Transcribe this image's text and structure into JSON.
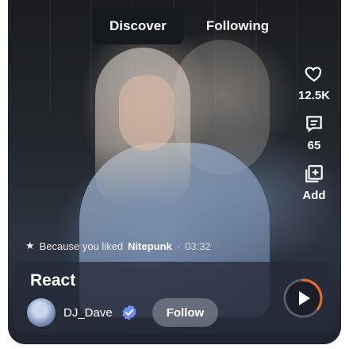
{
  "tabs": [
    {
      "label": "Discover",
      "active": true
    },
    {
      "label": "Following",
      "active": false
    }
  ],
  "rail": {
    "like_count": "12.5K",
    "comment_count": "65",
    "add_label": "Add"
  },
  "because": {
    "prefix": "Because you liked",
    "artist": "Nitepunk",
    "separator": "·",
    "duration": "03:32"
  },
  "track": {
    "title": "React",
    "artist": "DJ_Dave",
    "follow_label": "Follow",
    "progress": 0.35
  },
  "colors": {
    "accent_progress": "#f06a22",
    "verified": "#6f8ff0",
    "tab_active_bg": "#15181d"
  }
}
